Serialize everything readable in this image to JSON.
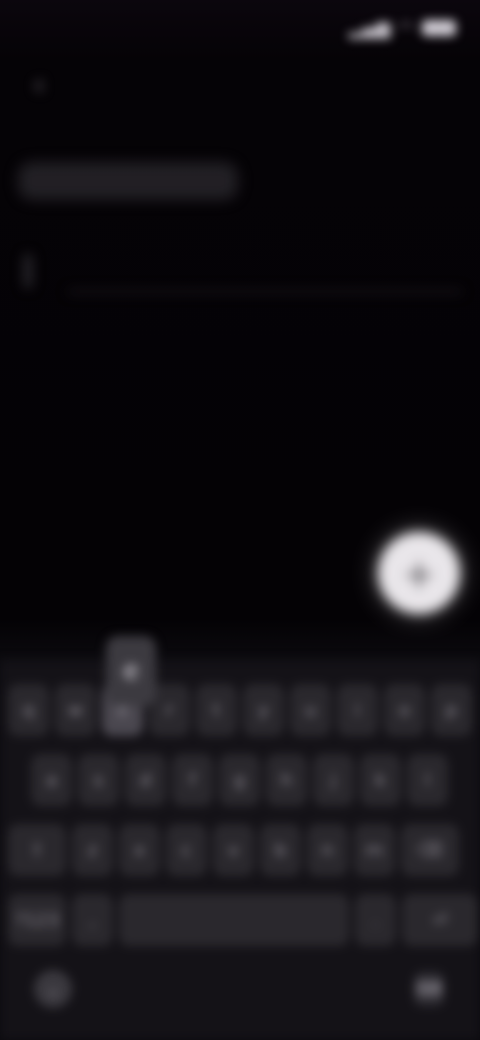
{
  "status_bar": {
    "time": "",
    "signal_icon": "signal-icon",
    "wifi_icon": "wifi-icon",
    "battery_icon": "battery-icon"
  },
  "app_bar": {
    "back_icon": "back-arrow-icon",
    "save_label": ""
  },
  "note": {
    "title_value": "",
    "body_value": ""
  },
  "fab": {
    "icon": "add-icon"
  },
  "keyboard": {
    "row1": [
      "q",
      "w",
      "e",
      "r",
      "t",
      "y",
      "u",
      "i",
      "o",
      "p"
    ],
    "row2": [
      "a",
      "s",
      "d",
      "f",
      "g",
      "h",
      "j",
      "k",
      "l"
    ],
    "row3": [
      "⇧",
      "z",
      "x",
      "c",
      "v",
      "b",
      "n",
      "m",
      "⌫"
    ],
    "row4": [
      "?123",
      ",",
      "",
      ".",
      " ⏎"
    ],
    "preview_key": "e",
    "nav_left_icon": "collapse-keyboard-icon",
    "nav_right_icon": "keyboard-switch-icon"
  },
  "colors": {
    "background": "#050306",
    "keyboard_bg": "#141217",
    "key_bg": "#2a282d",
    "fab": "#e9e6ea"
  }
}
